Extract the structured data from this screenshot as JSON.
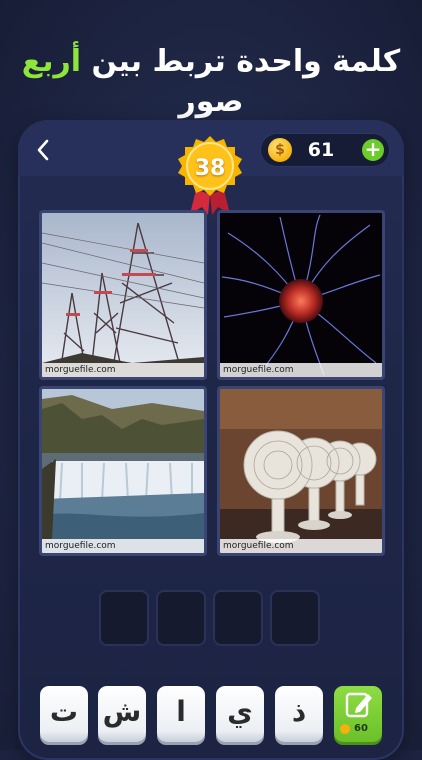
{
  "headline": {
    "part_before": "كلمة واحدة تربط بين ",
    "accent": "أربع",
    "part_after": " صور"
  },
  "toolbar": {
    "back_icon": "chevron-left-icon",
    "coins": "61",
    "coin_symbol": "$",
    "add_icon": "plus-icon"
  },
  "level": {
    "number": "38"
  },
  "images": [
    {
      "subject": "power-lines",
      "credit": "morguefile.com"
    },
    {
      "subject": "plasma-ball",
      "credit": "morguefile.com"
    },
    {
      "subject": "waterfall",
      "credit": "morguefile.com"
    },
    {
      "subject": "electric-fans",
      "credit": "morguefile.com"
    }
  ],
  "answer_slots": [
    "",
    "",
    "",
    ""
  ],
  "letters": [
    "ت",
    "ش",
    "ا",
    "ي",
    "ذ"
  ],
  "hint": {
    "icon": "pencil-icon",
    "cost": "60"
  },
  "colors": {
    "accent": "#8fe63a",
    "background": "#1d2340",
    "badge": "#f7b500",
    "hint_button": "#6cc02a"
  }
}
